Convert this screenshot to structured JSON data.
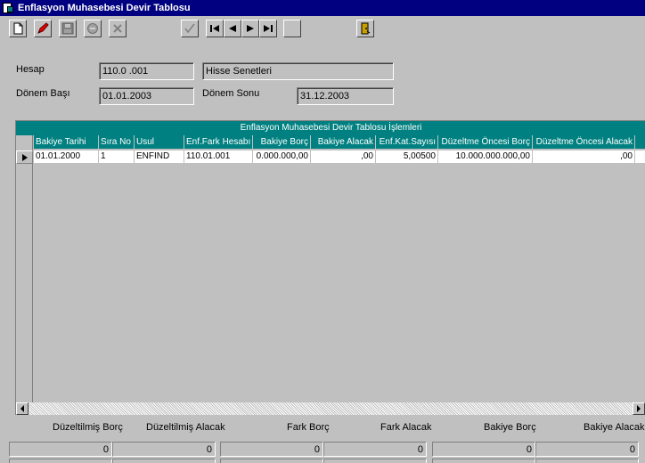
{
  "window": {
    "title": "Enflasyon Muhasebesi Devir Tablosu"
  },
  "form": {
    "hesap_label": "Hesap",
    "hesap_code": "110.0 .001",
    "hesap_name": "Hisse Senetleri",
    "donem_basi_label": "Dönem Başı",
    "donem_basi_value": "01.01.2003",
    "donem_sonu_label": "Dönem Sonu",
    "donem_sonu_value": "31.12.2003"
  },
  "grid": {
    "title": "Enflasyon Muhasebesi Devir Tablosu İşlemleri",
    "columns": [
      "Bakiye Tarihi",
      "Sıra No",
      "Usul",
      "Enf.Fark Hesabı",
      "Bakiye Borç",
      "Bakiye Alacak",
      "Enf.Kat.Sayısı",
      "Düzeltme Öncesi Borç",
      "Düzeltme Öncesi Alacak"
    ],
    "rows": [
      {
        "bakiye_tarihi": "01.01.2000",
        "sira_no": "1",
        "usul": "ENFIND",
        "enf_fark_hesabi": "110.01.001",
        "bakiye_borc": "0.000.000,00",
        "bakiye_alacak": ",00",
        "enf_kat_sayisi": "5,00500",
        "duzeltme_oncesi_borc": "10.000.000.000,00",
        "duzeltme_oncesi_alacak": ",00"
      }
    ]
  },
  "footer": {
    "labels": [
      "Düzeltilmiş Borç",
      "Düzeltilmiş Alacak",
      "Fark Borç",
      "Fark Alacak",
      "Bakiye Borç",
      "Bakiye Alacak"
    ],
    "values": [
      "0",
      "0",
      "0",
      "0",
      "0",
      "0"
    ]
  },
  "colors": {
    "titlebar": "#000080",
    "grid_header": "#008080",
    "face": "#c0c0c0"
  }
}
